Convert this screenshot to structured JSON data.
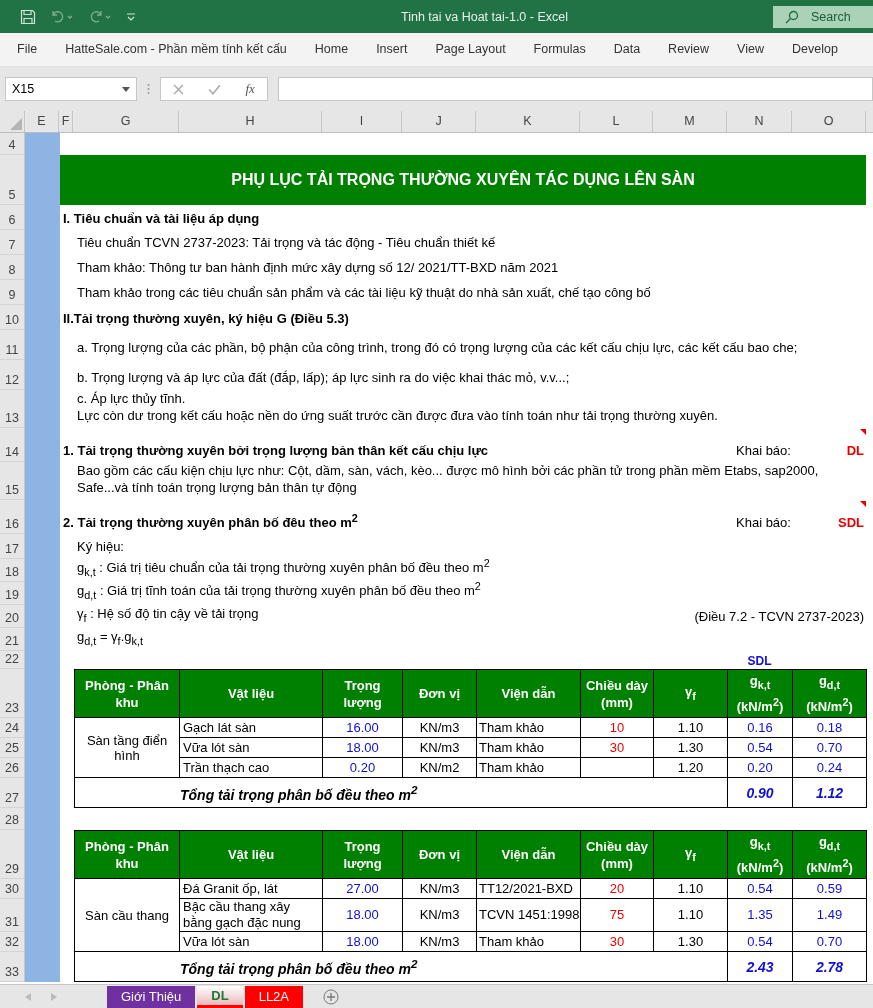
{
  "window": {
    "title": "Tinh tai va Hoat tai-1.0  -  Excel",
    "search_placeholder": "Search"
  },
  "ribbon_tabs": [
    {
      "label": "File",
      "selected": false
    },
    {
      "label": "HatteSale.com - Phần mềm tính kết cấu",
      "selected": false
    },
    {
      "label": "Home",
      "selected": false
    },
    {
      "label": "Insert",
      "selected": false
    },
    {
      "label": "Page Layout",
      "selected": false
    },
    {
      "label": "Formulas",
      "selected": false
    },
    {
      "label": "Data",
      "selected": false
    },
    {
      "label": "Review",
      "selected": false
    },
    {
      "label": "View",
      "selected": false
    },
    {
      "label": "Develop",
      "selected": false
    }
  ],
  "formula_bar": {
    "name_box": "X15",
    "function_label": "fx"
  },
  "column_headers": [
    "E",
    "F",
    "G",
    "H",
    "I",
    "J",
    "K",
    "L",
    "M",
    "N",
    "O"
  ],
  "rows": [
    {
      "num": "4",
      "kind": "blank"
    },
    {
      "num": "5",
      "kind": "banner",
      "text": "PHỤ LỤC TẢI TRỌNG THƯỜNG XUYÊN TÁC DỤNG LÊN SÀN"
    },
    {
      "num": "6",
      "kind": "heading",
      "text": "I. Tiêu chuẩn và tài liệu áp dụng"
    },
    {
      "num": "7",
      "kind": "note",
      "lines": [
        "Tiêu chuẩn TCVN 2737-2023: Tải trọng và tác động - Tiêu chuẩn thiết kế"
      ]
    },
    {
      "num": "8",
      "kind": "note",
      "lines": [
        "Tham khảo: Thông tư ban hành định mức xây dựng số 12/ 2021/TT-BXD năm 2021"
      ]
    },
    {
      "num": "9",
      "kind": "note",
      "lines": [
        "Tham khảo trong các tiêu chuẩn sản phẩm và các tài liệu kỹ thuật do nhà sản xuất, chế tạo công bố"
      ]
    },
    {
      "num": "10",
      "kind": "heading",
      "text": "II.Tải trọng thường xuyên, ký hiệu G (Điều 5.3)"
    },
    {
      "num": "11",
      "kind": "clause",
      "lines": [
        "a. Trọng lượng của các phần, bộ phận của công trình, trong đó có trọng lượng của các kết cấu chịu lực, các kết cấu bao che;"
      ]
    },
    {
      "num": "12",
      "kind": "clause",
      "lines": [
        "b. Trọng lượng và áp lực của đất (đắp, lấp); áp lực sinh ra do việc khai thác mỏ, v.v...;"
      ]
    },
    {
      "num": "13",
      "kind": "note",
      "lines": [
        "c. Áp lực thủy tĩnh.",
        "Lực còn dư trong kết cấu hoặc nền do ứng suất trước cần được đưa vào tính toán như tải trọng thường xuyên."
      ]
    },
    {
      "num": "14",
      "kind": "declare",
      "text": "1. Tải trọng thường xuyên bởi trọng lượng bản thân kết cấu chịu lực",
      "label": "Khai báo:",
      "code": "DL"
    },
    {
      "num": "15",
      "kind": "note",
      "lines": [
        "Bao gồm các cấu kiện chịu lực như: Cột, dầm, sàn, vách, kèo... được  mô hình bởi các phần tử trong phần mềm Etabs, sap2000,",
        "Safe...và tính toán trọng lượng bản thân tự động"
      ]
    },
    {
      "num": "16",
      "kind": "declare",
      "text": "2. Tải trọng thường xuyên phân bố đêu theo m$^{2}$",
      "label": "Khai báo:",
      "code": "SDL"
    },
    {
      "num": "17",
      "kind": "note",
      "lines": [
        "Ký hiệu:"
      ]
    },
    {
      "num": "18",
      "kind": "symbol",
      "text": "g$_{k,t}$ : Giá trị tiêu chuẩn của tải trọng thường xuyên phân bố đều theo m$^{2}$"
    },
    {
      "num": "19",
      "kind": "symbol",
      "text": "g$_{d,t}$ : Giá trị tĩnh toán của tải trọng thường xuyên phân bố đều theo m$^{2}$"
    },
    {
      "num": "20",
      "kind": "symbol",
      "text": "γ$_{f}$ : Hệ số độ tin cậy về tải trọng",
      "ref": "(Điều 7.2 - TCVN 2737-2023)"
    },
    {
      "num": "21",
      "kind": "symbol",
      "text": "g$_{d,t}$ = γ$_{f}$.g$_{k,t}$"
    },
    {
      "num": "22",
      "kind": "caption",
      "text": "SDL"
    },
    {
      "num": "23",
      "kind": "table",
      "headers": [
        "Phòng - Phân khu",
        "Vật liệu",
        "Trọng lượng",
        "Đơn vị",
        "Viện dẫn",
        "Chiều dày (mm)",
        "γ$_{f}$",
        "g$_{k,t}$ (kN/m$^{2}$)",
        "g$_{d,t}$ (kN/m$^{2}$)"
      ],
      "zone": "Sàn tầng điển hình",
      "items": [
        {
          "num": "24",
          "material": "Gạch lát sàn",
          "weight": "16.00",
          "unit": "KN/m3",
          "ref": "Tham khảo",
          "thickness": "10",
          "gamma": "1.10",
          "gkt": "0.16",
          "gdt": "0.18"
        },
        {
          "num": "25",
          "material": "Vữa lót sàn",
          "weight": "18.00",
          "unit": "KN/m3",
          "ref": "Tham khảo",
          "thickness": "30",
          "gamma": "1.30",
          "gkt": "0.54",
          "gdt": "0.70"
        },
        {
          "num": "26",
          "material": "Trần thạch cao",
          "weight": "0.20",
          "unit": "KN/m2",
          "ref": "Tham khảo",
          "gamma": "1.20",
          "gkt": "0.20",
          "gdt": "0.24"
        }
      ],
      "total": {
        "num": "27",
        "label": "Tổng tải trọng phân bố đều theo m$^{2}$",
        "gkt": "0.90",
        "gdt": "1.12"
      }
    },
    {
      "num": "28",
      "kind": "blank"
    },
    {
      "num": "29",
      "kind": "table",
      "headers": [
        "Phòng - Phân khu",
        "Vật liệu",
        "Trọng lượng",
        "Đơn vị",
        "Viện dẫn",
        "Chiều dày (mm)",
        "γ$_{f}$",
        "g$_{k,t}$ (kN/m$^{2}$)",
        "g$_{d,t}$ (kN/m$^{2}$)"
      ],
      "zone": "Sàn cầu thang",
      "items": [
        {
          "num": "30",
          "material": "Đá Granit ốp, lát",
          "weight": "27.00",
          "unit": "KN/m3",
          "ref": "TT12/2021-BXD",
          "thickness": "20",
          "gamma": "1.10",
          "gkt": "0.54",
          "gdt": "0.59"
        },
        {
          "num": "31",
          "material": "Bậc cầu thang xây bằng gạch đặc nung",
          "weight": "18.00",
          "unit": "KN/m3",
          "ref": "TCVN 1451:1998",
          "thickness": "75",
          "gamma": "1.10",
          "gkt": "1.35",
          "gdt": "1.49"
        },
        {
          "num": "32",
          "material": "Vữa lót sàn",
          "weight": "18.00",
          "unit": "KN/m3",
          "ref": "Tham khảo",
          "thickness": "30",
          "gamma": "1.30",
          "gkt": "0.54",
          "gdt": "0.70"
        }
      ],
      "total": {
        "num": "33",
        "label": "Tổng tải trọng phân bố đều theo m$^{2}$",
        "gkt": "2.43",
        "gdt": "2.78"
      }
    }
  ],
  "sheet_tabs": [
    {
      "label": "Giới Thiệu",
      "selected": false,
      "color": "#7030a0"
    },
    {
      "label": "DL",
      "selected": true,
      "color": "#ff0000"
    },
    {
      "label": "LL2A",
      "selected": false,
      "color": "#ff0000"
    }
  ]
}
